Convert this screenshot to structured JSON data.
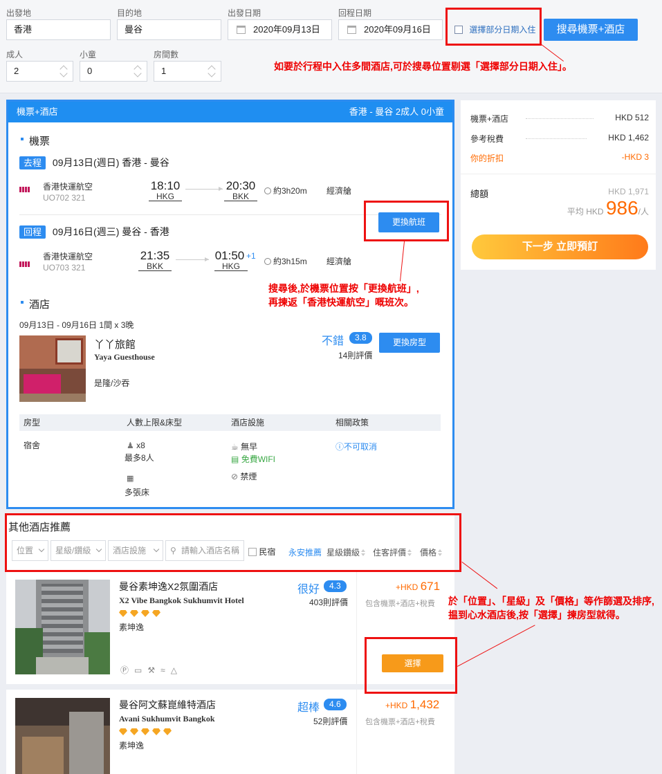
{
  "search": {
    "origin_label": "出發地",
    "origin_value": "香港",
    "dest_label": "目的地",
    "dest_value": "曼谷",
    "depart_label": "出發日期",
    "depart_value": "2020年09月13日",
    "return_label": "回程日期",
    "return_value": "2020年09月16日",
    "partial_label": "選擇部分日期入住",
    "search_button": "搜尋機票+酒店",
    "adults_label": "成人",
    "adults_value": "2",
    "children_label": "小童",
    "children_value": "0",
    "rooms_label": "房間數",
    "rooms_value": "1"
  },
  "annotations": {
    "note1": "如要於行程中入住多間酒店,可於搜尋位置剔選「選擇部分日期入住」。",
    "note2_line1": "搜尋後,於機票位置按「更換航班」,",
    "note2_line2": "再揀返「香港快運航空」嘅班次。",
    "note3_line1": "於「位置」、「星級」及「價格」等作篩選及排序,",
    "note3_line2": "揾到心水酒店後,按「選擇」揀房型就得。"
  },
  "package": {
    "header_title": "機票+酒店",
    "header_summary": "香港 - 曼谷  2成人 0小童",
    "flight_section": "機票",
    "outbound": {
      "tag": "去程",
      "date_route": "09月13日(週日)  香港 - 曼谷",
      "airline": "香港快運航空",
      "flight_no": "UO702 321",
      "dep_time": "18:10",
      "dep_code": "HKG",
      "arr_time": "20:30",
      "arr_code": "BKK",
      "arr_plus": "",
      "duration": "約3h20m",
      "cabin": "經濟艙"
    },
    "inbound": {
      "tag": "回程",
      "date_route": "09月16日(週三)  曼谷 - 香港",
      "airline": "香港快運航空",
      "flight_no": "UO703 321",
      "dep_time": "21:35",
      "dep_code": "BKK",
      "arr_time": "01:50",
      "arr_code": "HKG",
      "arr_plus": "+1",
      "duration": "約3h15m",
      "cabin": "經濟艙"
    },
    "change_flight_button": "更換航班",
    "hotel_section": "酒店",
    "hotel_dates": "09月13日 - 09月16日 1間 x 3晚",
    "hotel_name": "丫丫旅館",
    "hotel_name_en": "Yaya Guesthouse",
    "hotel_area": "是隆/沙吞",
    "hotel_rating_word": "不錯",
    "hotel_score": "3.8",
    "hotel_reviews": "14則評價",
    "change_room_button": "更換房型",
    "room_table": {
      "headers": [
        "房型",
        "人數上限&床型",
        "酒店設施",
        "相關政策"
      ],
      "room_type": "宿舍",
      "occupancy": "x8",
      "occupancy_note": "最多8人",
      "bed": "多張床",
      "facility_breakfast": "無早",
      "facility_wifi": "免費WIFI",
      "facility_smoke": "禁煙",
      "policy": "不可取消"
    }
  },
  "summary": {
    "row1_label": "機票+酒店",
    "row1_value": "HKD 512",
    "row2_label": "參考稅費",
    "row2_value": "HKD 1,462",
    "row3_label": "你的折扣",
    "row3_value": "-HKD 3",
    "total_label": "總額",
    "total_value": "HKD 1,971",
    "avg_prefix": "平均 HKD",
    "avg_value": "986",
    "avg_suffix": "/人",
    "next_button": "下一步 立即預訂"
  },
  "others": {
    "title": "其他酒店推薦",
    "filter_location": "位置",
    "filter_star": "星級/鑽級",
    "filter_facility": "酒店設施",
    "filter_search_placeholder": "請輸入酒店名稱",
    "filter_homestay": "民宿",
    "sort_recommended": "永安推薦",
    "sort_star": "星級鑽級",
    "sort_review": "住客評價",
    "sort_price": "價格",
    "hotels": [
      {
        "name": "曼谷素坤逸X2氛圍酒店",
        "name_en": "X2 Vibe Bangkok Sukhumvit Hotel",
        "area": "素坤逸",
        "rating_word": "很好",
        "score": "4.3",
        "reviews": "403則評價",
        "price_prefix": "+HKD",
        "price": "671",
        "price_note": "包含機票+酒店+稅費",
        "select_button": "選擇",
        "diamonds": 4
      },
      {
        "name": "曼谷阿文蘇崑維特酒店",
        "name_en": "Avani Sukhumvit Bangkok",
        "area": "素坤逸",
        "rating_word": "超棒",
        "score": "4.6",
        "reviews": "52則評價",
        "price_prefix": "+HKD",
        "price": "1,432",
        "price_note": "包含機票+酒店+稅費",
        "diamonds": 5
      }
    ]
  },
  "colors": {
    "accent": "#2d8cf0",
    "annotation_red": "#e11111",
    "orange": "#f79a1a",
    "price_orange": "#ff6a00"
  }
}
